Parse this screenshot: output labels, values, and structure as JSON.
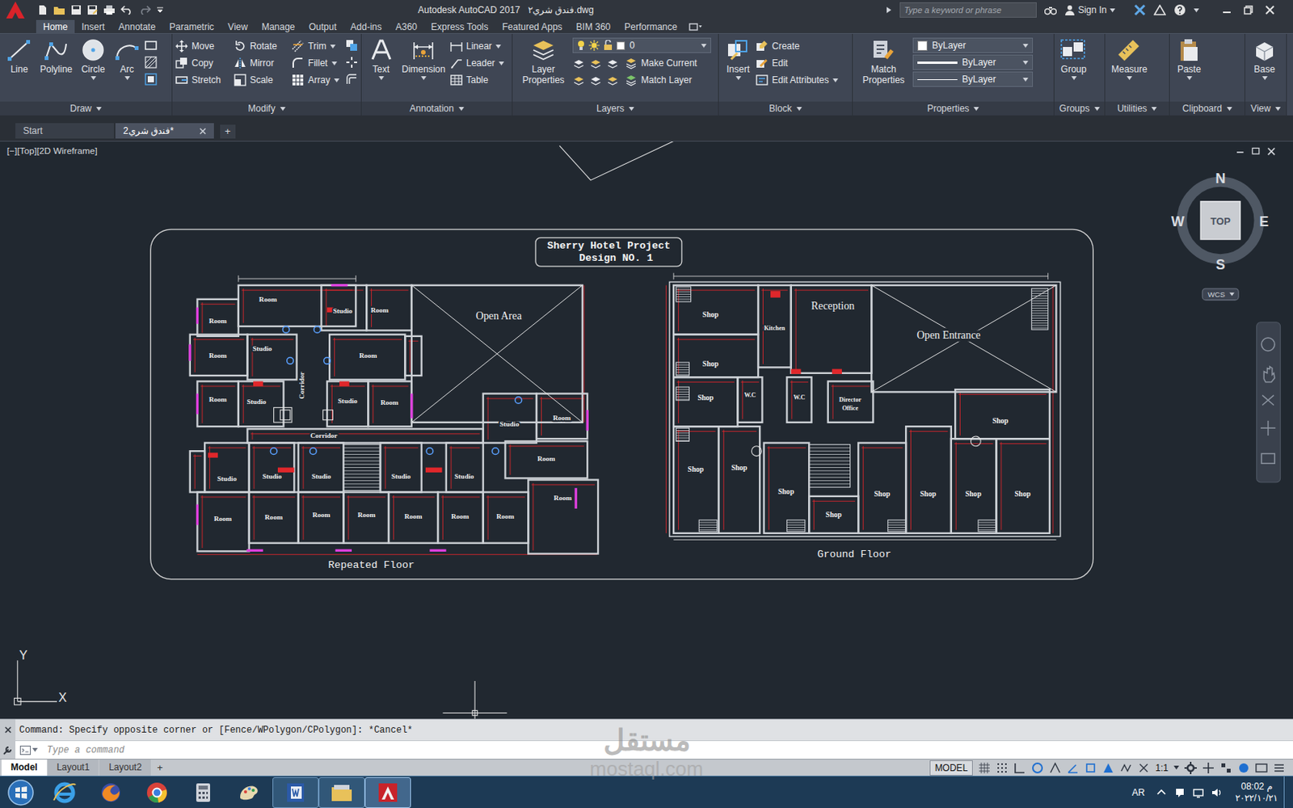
{
  "title_bar": {
    "app": "Autodesk AutoCAD 2017",
    "file": "فندق شري٢.dwg",
    "search_placeholder": "Type a keyword or phrase",
    "sign_in": "Sign In"
  },
  "ribbon_tabs": [
    {
      "label": "Home",
      "selected": true
    },
    {
      "label": "Insert",
      "selected": false
    },
    {
      "label": "Annotate",
      "selected": false
    },
    {
      "label": "Parametric",
      "selected": false
    },
    {
      "label": "View",
      "selected": false
    },
    {
      "label": "Manage",
      "selected": false
    },
    {
      "label": "Output",
      "selected": false
    },
    {
      "label": "Add-ins",
      "selected": false
    },
    {
      "label": "A360",
      "selected": false
    },
    {
      "label": "Express Tools",
      "selected": false
    },
    {
      "label": "Featured Apps",
      "selected": false
    },
    {
      "label": "BIM 360",
      "selected": false
    },
    {
      "label": "Performance",
      "selected": false
    }
  ],
  "ribbon_panels": [
    {
      "title": "Draw",
      "large": [
        {
          "label": "Line",
          "dropdown": false
        },
        {
          "label": "Polyline",
          "dropdown": false
        },
        {
          "label": "Circle",
          "dropdown": true
        },
        {
          "label": "Arc",
          "dropdown": true
        }
      ],
      "selects": [],
      "small": []
    },
    {
      "title": "Modify",
      "large": [],
      "selects": [],
      "small": [
        {
          "label": "Move",
          "dropdown": false
        },
        {
          "label": "Rotate",
          "dropdown": false
        },
        {
          "label": "Trim",
          "dropdown": true
        },
        {
          "label": "Copy",
          "dropdown": false
        },
        {
          "label": "Mirror",
          "dropdown": false
        },
        {
          "label": "Fillet",
          "dropdown": true
        },
        {
          "label": "Stretch",
          "dropdown": false
        },
        {
          "label": "Scale",
          "dropdown": false
        },
        {
          "label": "Array",
          "dropdown": true
        }
      ]
    },
    {
      "title": "Annotation",
      "large": [
        {
          "label": "Text",
          "dropdown": true
        },
        {
          "label": "Dimension",
          "dropdown": true
        }
      ],
      "selects": [],
      "small": [
        {
          "label": "Linear",
          "dropdown": true
        },
        {
          "label": "Leader",
          "dropdown": true
        },
        {
          "label": "Table",
          "dropdown": false
        }
      ]
    },
    {
      "title": "Layers",
      "large": [
        {
          "label": "Layer Properties",
          "dropdown": false
        }
      ],
      "selects": [
        {
          "kind": "layer",
          "value": "0"
        }
      ],
      "small": [
        {
          "label": "Make Current",
          "dropdown": false
        },
        {
          "label": "Match Layer",
          "dropdown": false
        }
      ]
    },
    {
      "title": "Block",
      "large": [
        {
          "label": "Insert",
          "dropdown": true
        }
      ],
      "selects": [],
      "small": [
        {
          "label": "Create",
          "dropdown": false
        },
        {
          "label": "Edit",
          "dropdown": false
        },
        {
          "label": "Edit Attributes",
          "dropdown": true
        }
      ]
    },
    {
      "title": "Properties",
      "large": [
        {
          "label": "Match Properties",
          "dropdown": false
        }
      ],
      "selects": [
        {
          "kind": "color",
          "value": "ByLayer"
        },
        {
          "kind": "lineweight",
          "value": "ByLayer"
        },
        {
          "kind": "linetype",
          "value": "ByLayer"
        }
      ],
      "small": []
    },
    {
      "title": "Groups",
      "large": [
        {
          "label": "Group",
          "dropdown": true
        }
      ],
      "selects": [],
      "small": []
    },
    {
      "title": "Utilities",
      "large": [
        {
          "label": "Measure",
          "dropdown": true
        }
      ],
      "selects": [],
      "small": []
    },
    {
      "title": "Clipboard",
      "large": [
        {
          "label": "Paste",
          "dropdown": true
        }
      ],
      "selects": [],
      "small": []
    },
    {
      "title": "View",
      "large": [
        {
          "label": "Base",
          "dropdown": true
        }
      ],
      "selects": [],
      "small": []
    }
  ],
  "file_tabs": [
    {
      "label": "Start",
      "selected": false,
      "closable": false
    },
    {
      "label": "فندق شري2*",
      "selected": true,
      "closable": true
    }
  ],
  "new_tab": "+",
  "viewport": {
    "label": "[−][Top][2D Wireframe]"
  },
  "viewcube": {
    "north": "N",
    "south": "S",
    "east": "E",
    "west": "W",
    "face": "TOP",
    "ucs": "WCS"
  },
  "ucs_icon": {
    "x": "X",
    "y": "Y"
  },
  "drawing": {
    "title_lines": [
      "Sherry Hotel Project",
      "Design NO. 1"
    ],
    "plans": [
      {
        "name": "Repeated Floor",
        "rooms": [
          "Room",
          "Studio",
          "Room",
          "Room",
          "Studio",
          "Room",
          "Room",
          "Corridor",
          "Room",
          "Studio",
          "Studio",
          "Room",
          "Corridor",
          "Studio",
          "Room",
          "Studio",
          "Studio",
          "Studio",
          "Studio",
          "Studio",
          "Room",
          "Room",
          "Room",
          "Room",
          "Room",
          "Room",
          "Room",
          "Room",
          "Room",
          "Open Area"
        ]
      },
      {
        "name": "Ground Floor",
        "rooms": [
          "Reception",
          "Shop",
          "Kitchen",
          "Open Entrance",
          "Shop",
          "W.C",
          "W.C",
          "Shop",
          "Director",
          "Office",
          "Shop",
          "Shop",
          "Shop",
          "Shop",
          "Shop",
          "Shop",
          "Shop",
          "Shop",
          "Shop"
        ]
      }
    ]
  },
  "command": {
    "history": "Command: Specify opposite corner or [Fence/WPolygon/CPolygon]: *Cancel*",
    "placeholder": "Type a command"
  },
  "layout_tabs": [
    {
      "label": "Model",
      "selected": true
    },
    {
      "label": "Layout1",
      "selected": false
    },
    {
      "label": "Layout2",
      "selected": false
    }
  ],
  "add_layout": "+",
  "status_bar": {
    "space": "MODEL",
    "scale": "1:1"
  },
  "taskbar": {
    "language": "AR",
    "time": "08:02 م",
    "date": "٢٠٢٢/١٠/٢١"
  },
  "watermark": {
    "logo": "مستقل",
    "site": "mostaql.com"
  }
}
